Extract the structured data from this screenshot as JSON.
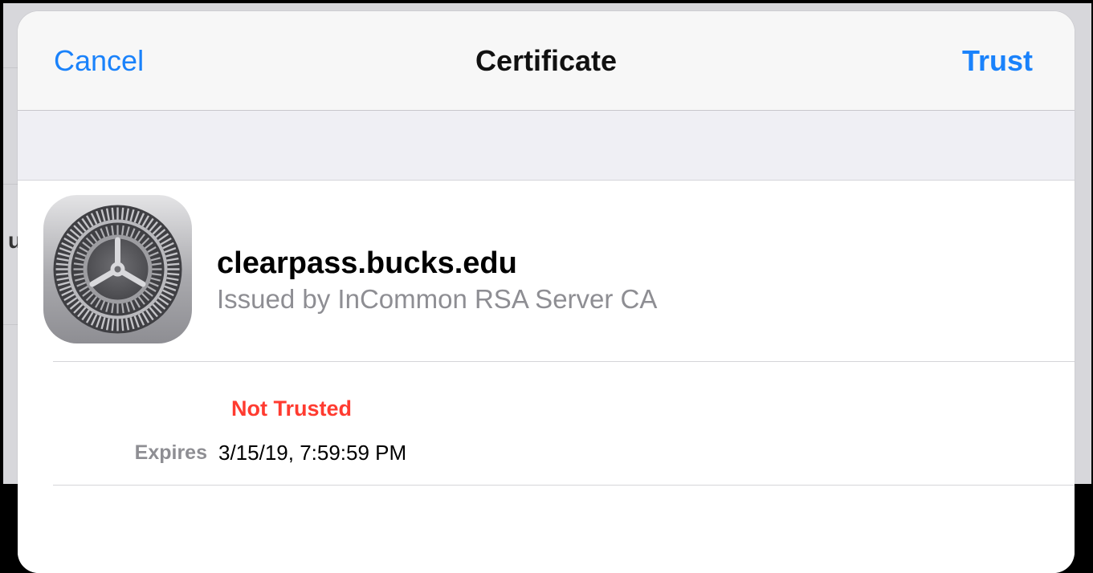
{
  "navbar": {
    "cancel_label": "Cancel",
    "title": "Certificate",
    "trust_label": "Trust"
  },
  "certificate": {
    "icon": "settings-gear-icon",
    "name": "clearpass.bucks.edu",
    "issuer": "Issued by InCommon RSA Server CA",
    "status": "Not Trusted",
    "expires_label": "Expires",
    "expires_value": "3/15/19, 7:59:59 PM"
  },
  "colors": {
    "accent": "#1a82fb",
    "danger": "#ff3b30",
    "secondary_text": "#8e8e93",
    "navbar_bg": "#f7f7f7",
    "grouped_bg": "#efeff4"
  }
}
